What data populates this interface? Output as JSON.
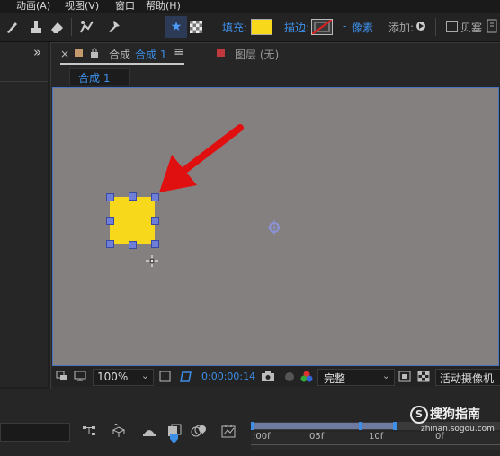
{
  "menu": {
    "items": [
      "动画(A)",
      "视图(V)",
      "窗口",
      "帮助(H)"
    ]
  },
  "toolbar": {
    "fill_label": "填充:",
    "stroke_label": "描边:",
    "stroke_dash": "-",
    "stroke_unit": "像素",
    "add_label": "添加:",
    "bezier_label": "贝塞",
    "fill_color": "#f7d81a",
    "accent_color": "#3d8ee6"
  },
  "left_panel": {
    "expand_label": "»"
  },
  "comp_panel": {
    "close_label": "×",
    "title_prefix": "合成",
    "active_comp": "合成 1",
    "menu_icon": "≡",
    "layer_panel": "图层 (无)",
    "comp_tab": "合成 1"
  },
  "viewer": {
    "zoom": "100%",
    "timecode": "0:00:00:14",
    "quality": "完整",
    "camera": "活动摄像机"
  },
  "timeline": {
    "ticks": [
      ":00f",
      "05f",
      "10f"
    ],
    "cti_label": "0f"
  },
  "watermark": {
    "logo_text": "搜狗指南",
    "url": "zhinan.sogou.com"
  },
  "shape": {
    "color": "#f7d81a"
  }
}
